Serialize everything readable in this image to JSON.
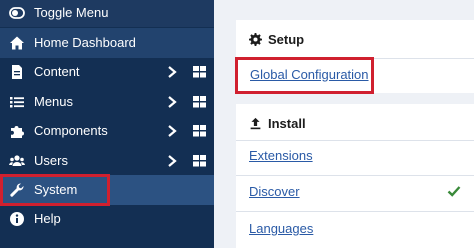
{
  "sidebar": {
    "toggle_label": "Toggle Menu",
    "items": [
      {
        "label": "Home Dashboard",
        "icon": "home-icon"
      },
      {
        "label": "Content",
        "icon": "file-icon"
      },
      {
        "label": "Menus",
        "icon": "list-icon"
      },
      {
        "label": "Components",
        "icon": "puzzle-icon"
      },
      {
        "label": "Users",
        "icon": "users-icon"
      },
      {
        "label": "System",
        "icon": "wrench-icon"
      },
      {
        "label": "Help",
        "icon": "info-icon"
      }
    ]
  },
  "main": {
    "setup": {
      "title": "Setup",
      "links": [
        "Global Configuration"
      ]
    },
    "install": {
      "title": "Install",
      "links": [
        "Extensions",
        "Discover",
        "Languages"
      ]
    }
  },
  "colors": {
    "sidebar_bg": "#132f53",
    "selected_bg": "#2c5282",
    "highlight": "#d0202f",
    "link": "#2a5aa6",
    "check": "#3a8a3a"
  }
}
